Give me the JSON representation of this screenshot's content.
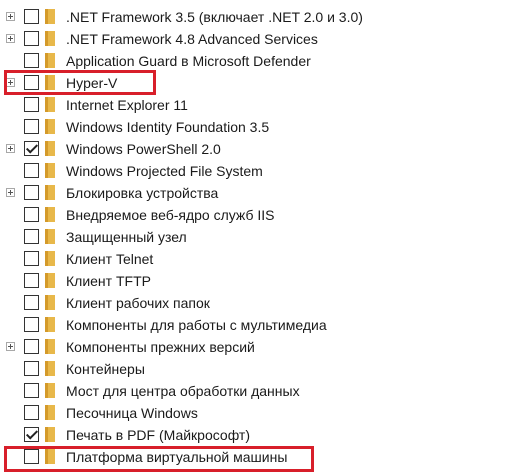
{
  "features": [
    {
      "label": ".NET Framework 3.5 (включает .NET 2.0 и 3.0)",
      "expandable": true,
      "checked": false
    },
    {
      "label": ".NET Framework 4.8 Advanced Services",
      "expandable": true,
      "checked": false
    },
    {
      "label": "Application Guard в Microsoft Defender",
      "expandable": false,
      "checked": false
    },
    {
      "label": "Hyper-V",
      "expandable": true,
      "checked": false
    },
    {
      "label": "Internet Explorer 11",
      "expandable": false,
      "checked": false
    },
    {
      "label": "Windows Identity Foundation 3.5",
      "expandable": false,
      "checked": false
    },
    {
      "label": "Windows PowerShell 2.0",
      "expandable": true,
      "checked": true
    },
    {
      "label": "Windows Projected File System",
      "expandable": false,
      "checked": false
    },
    {
      "label": "Блокировка устройства",
      "expandable": true,
      "checked": false
    },
    {
      "label": "Внедряемое веб-ядро служб IIS",
      "expandable": false,
      "checked": false
    },
    {
      "label": "Защищенный узел",
      "expandable": false,
      "checked": false
    },
    {
      "label": "Клиент Telnet",
      "expandable": false,
      "checked": false
    },
    {
      "label": "Клиент TFTP",
      "expandable": false,
      "checked": false
    },
    {
      "label": "Клиент рабочих папок",
      "expandable": false,
      "checked": false
    },
    {
      "label": "Компоненты для работы с мультимедиа",
      "expandable": false,
      "checked": false
    },
    {
      "label": "Компоненты прежних версий",
      "expandable": true,
      "checked": false
    },
    {
      "label": "Контейнеры",
      "expandable": false,
      "checked": false
    },
    {
      "label": "Мост для центра обработки данных",
      "expandable": false,
      "checked": false
    },
    {
      "label": "Песочница Windows",
      "expandable": false,
      "checked": false
    },
    {
      "label": "Печать в PDF (Майкрософт)",
      "expandable": false,
      "checked": true
    },
    {
      "label": "Платформа виртуальной машины",
      "expandable": false,
      "checked": false
    }
  ],
  "colors": {
    "folder": "#e8b84a",
    "folder_dark": "#d49a2a",
    "highlight": "#d81f2a"
  }
}
